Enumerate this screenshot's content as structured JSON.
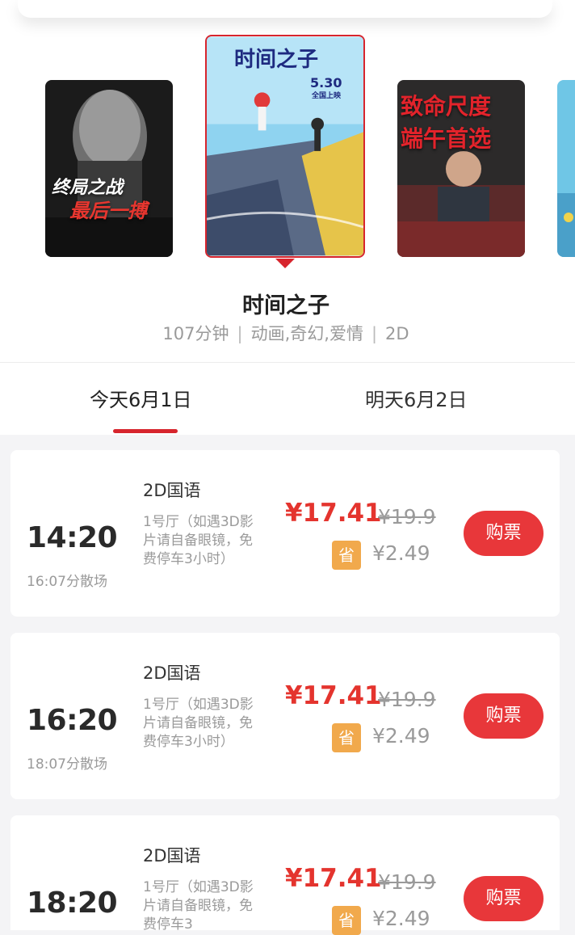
{
  "movies": [
    {
      "caption_line1": "终局之战",
      "caption_line2": "最后一搏"
    },
    {
      "poster_title": "时间之子",
      "poster_date": "5.30",
      "poster_sub": "全国上映"
    },
    {
      "caption_line1": "致命尺度",
      "caption_line2": "端午首选"
    }
  ],
  "selected_movie": {
    "title": "时间之子",
    "duration": "107分钟",
    "genres": "动画,奇幻,爱情",
    "format": "2D"
  },
  "date_tabs": [
    {
      "label": "今天6月1日",
      "active": true
    },
    {
      "label": "明天6月2日",
      "active": false
    }
  ],
  "showtimes": [
    {
      "time": "14:20",
      "end": "16:07分散场",
      "language": "2D国语",
      "hall": "1号厅（如遇3D影片请自备眼镜，免费停车3小时）",
      "price": "¥17.41",
      "original_price": "¥19.9",
      "save_label": "省",
      "save_amount": "¥2.49",
      "buy_label": "购票"
    },
    {
      "time": "16:20",
      "end": "18:07分散场",
      "language": "2D国语",
      "hall": "1号厅（如遇3D影片请自备眼镜，免费停车3小时）",
      "price": "¥17.41",
      "original_price": "¥19.9",
      "save_label": "省",
      "save_amount": "¥2.49",
      "buy_label": "购票"
    },
    {
      "time": "18:20",
      "end": "",
      "language": "2D国语",
      "hall": "1号厅（如遇3D影片请自备眼镜，免费停车3",
      "price": "¥17.41",
      "original_price": "¥19.9",
      "save_label": "省",
      "save_amount": "¥2.49",
      "buy_label": "购票"
    }
  ],
  "colors": {
    "accent": "#d7252d",
    "buy": "#e8373a",
    "save_badge": "#f1a94c"
  }
}
